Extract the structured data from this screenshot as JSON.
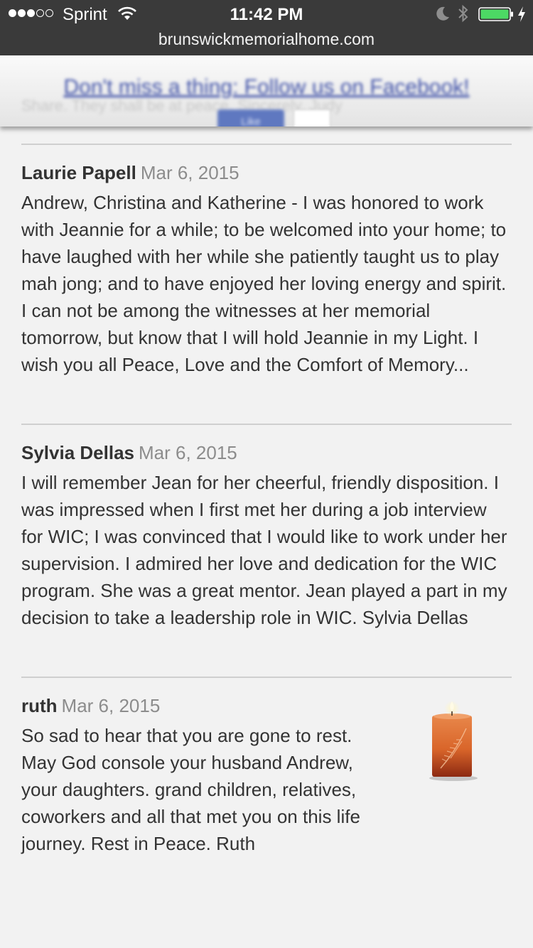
{
  "status_bar": {
    "carrier": "Sprint",
    "time": "11:42 PM",
    "battery_color": "#4cd964"
  },
  "browser": {
    "url": "brunswickmemorialhome.com"
  },
  "promo": {
    "text": "Don't miss a thing: Follow us on Facebook!",
    "like_label": "Like",
    "behind_text": "Share. They shall be at peace. Sincerely, Judy",
    "like_color": "#5f78c0",
    "link_color": "#3f51a8"
  },
  "entries": [
    {
      "author": "Laurie Papell",
      "date": "Mar 6, 2015",
      "message": "Andrew, Christina and Katherine - I was honored to work with Jeannie for a while; to be welcomed into your home; to have laughed with her while she patiently taught us to play mah jong; and to have enjoyed her loving energy and spirit. I can not be among the witnesses at her memorial tomorrow, but know that I will hold Jeannie in my Light. I wish you all Peace, Love and the Comfort of Memory..."
    },
    {
      "author": "Sylvia Dellas",
      "date": "Mar 6, 2015",
      "message": "I will remember Jean for her cheerful, friendly disposition. I was impressed when I first met her during a job interview for WIC; I was convinced that I would like to work under her supervision. I admired her love and dedication for the WIC program. She was a great mentor. Jean played a part in my decision to take a leadership role in WIC. Sylvia Dellas"
    },
    {
      "author": "ruth",
      "date": "Mar 6, 2015",
      "message": "So sad to hear that you are gone to rest. May God console your husband Andrew, your daughters. grand children, relatives, coworkers and all that met you on this life journey. Rest in Peace. Ruth",
      "icon": "candle-icon",
      "candle_color": "#d9652a"
    }
  ]
}
